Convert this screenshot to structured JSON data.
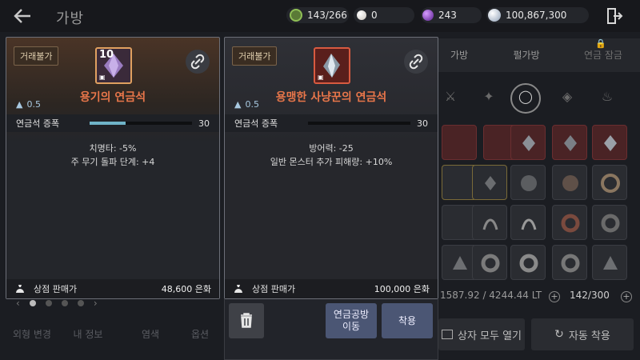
{
  "header": {
    "title": "가방",
    "currencies": [
      {
        "icon": "green-badge-icon",
        "value": "143/266",
        "color": "#7fb04a"
      },
      {
        "icon": "pearl-icon",
        "value": "0",
        "color": "#e8e4df"
      },
      {
        "icon": "purple-orb-icon",
        "value": "243",
        "color": "#8a3fd0"
      },
      {
        "icon": "silver-coin-icon",
        "value": "100,867,300",
        "color": "#cfd6e0"
      }
    ]
  },
  "inventory": {
    "tabs": [
      "가방",
      "펄가방",
      "연금 잠금"
    ],
    "weight": "1587.92 / 4244.44 LT",
    "slots": "142/300",
    "open_all": "상자 모두 열기",
    "auto_equip": "자동 착용"
  },
  "left_menu": [
    "외형 변경",
    "내 정보",
    "염색",
    "옵션"
  ],
  "cards": [
    {
      "trade": "거래불가",
      "icon_level": "10",
      "name": "용기의 연금석",
      "weight": "0.5",
      "amp_label": "연금석 증폭",
      "amp_value": "30",
      "amp_fraction": 0.35,
      "stats": [
        "치명타: -5%",
        "주 무기 돌파 단계: +4"
      ],
      "sell_label": "상점 판매가",
      "sell_value": "48,600 은화"
    },
    {
      "trade": "거래불가",
      "name": "용맹한 사냥꾼의 연금석",
      "weight": "0.5",
      "amp_label": "연금석 증폭",
      "amp_value": "30",
      "amp_fraction": 0,
      "stats": [
        "방어력: -25",
        "일반 몬스터 추가 피해량: +10%"
      ],
      "sell_label": "상점 판매가",
      "sell_value": "100,000 은화"
    }
  ],
  "actions": {
    "move_to_alchemy": "연금공방 이동",
    "equip": "착용"
  },
  "colors": {
    "item_name": "#e8764a",
    "weight_text": "#a8c8e0",
    "amp_fill": "#6fb3c8",
    "action_button": "#4b5674"
  }
}
